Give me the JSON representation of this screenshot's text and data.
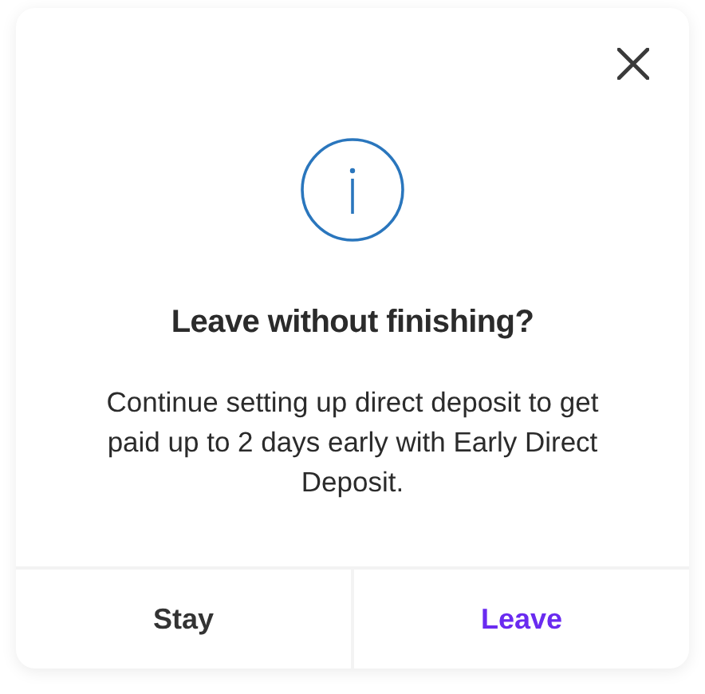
{
  "dialog": {
    "title": "Leave without finishing?",
    "message": "Continue setting up direct deposit to get paid up to 2 days early with Early Direct Deposit.",
    "buttons": [
      {
        "label": "Stay",
        "kind": "default"
      },
      {
        "label": "Leave",
        "kind": "accent"
      }
    ]
  }
}
